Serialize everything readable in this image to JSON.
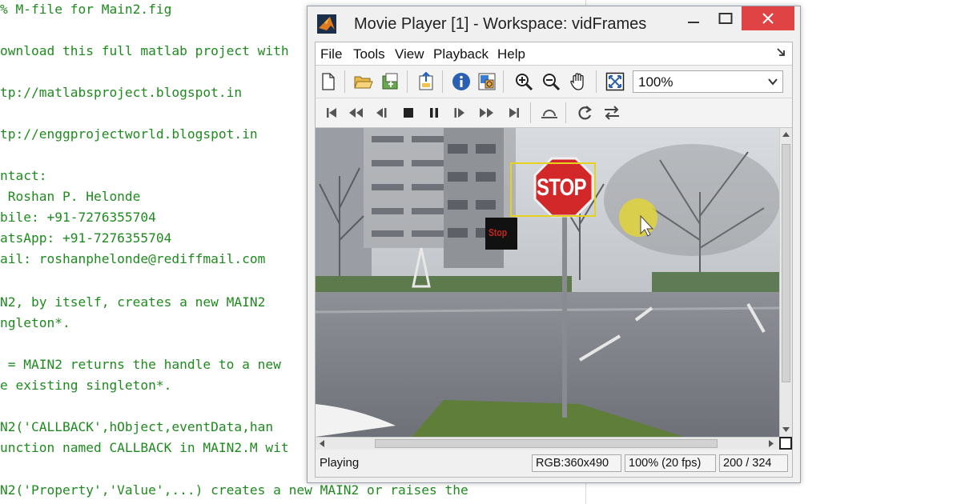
{
  "editor": {
    "lines": [
      "% M-file for Main2.fig",
      "",
      "ownload this full matlab project with",
      "",
      "tp://matlabsproject.blogspot.in",
      "",
      "tp://enggprojectworld.blogspot.in",
      "",
      "ntact:",
      " Roshan P. Helonde",
      "bile: +91-7276355704",
      "atsApp: +91-7276355704",
      "ail: roshanphelonde@rediffmail.com",
      "",
      "N2, by itself, creates a new MAIN2",
      "ngleton*.",
      "",
      " = MAIN2 returns the handle to a new",
      "e existing singleton*.",
      "",
      "N2('CALLBACK',hObject,eventData,han",
      "unction named CALLBACK in MAIN2.M wit",
      "",
      "N2('Property','Value',...) creates a new MAIN2 or raises the"
    ]
  },
  "window": {
    "title": "Movie Player [1] - Workspace: vidFrames"
  },
  "menu": [
    "File",
    "Tools",
    "View",
    "Playback",
    "Help"
  ],
  "zoom": {
    "value": "100%"
  },
  "video": {
    "sign_text": "STOP",
    "label_text": "Stop"
  },
  "status": {
    "state": "Playing",
    "rgb": "RGB:360x490",
    "zoom_fps": "100% (20 fps)",
    "frame": "200 / 324"
  },
  "colors": {
    "code_text": "#1f8a1f",
    "close_button": "#e04343",
    "detection_box": "#e6d21c",
    "stop_sign": "#d2282a"
  }
}
